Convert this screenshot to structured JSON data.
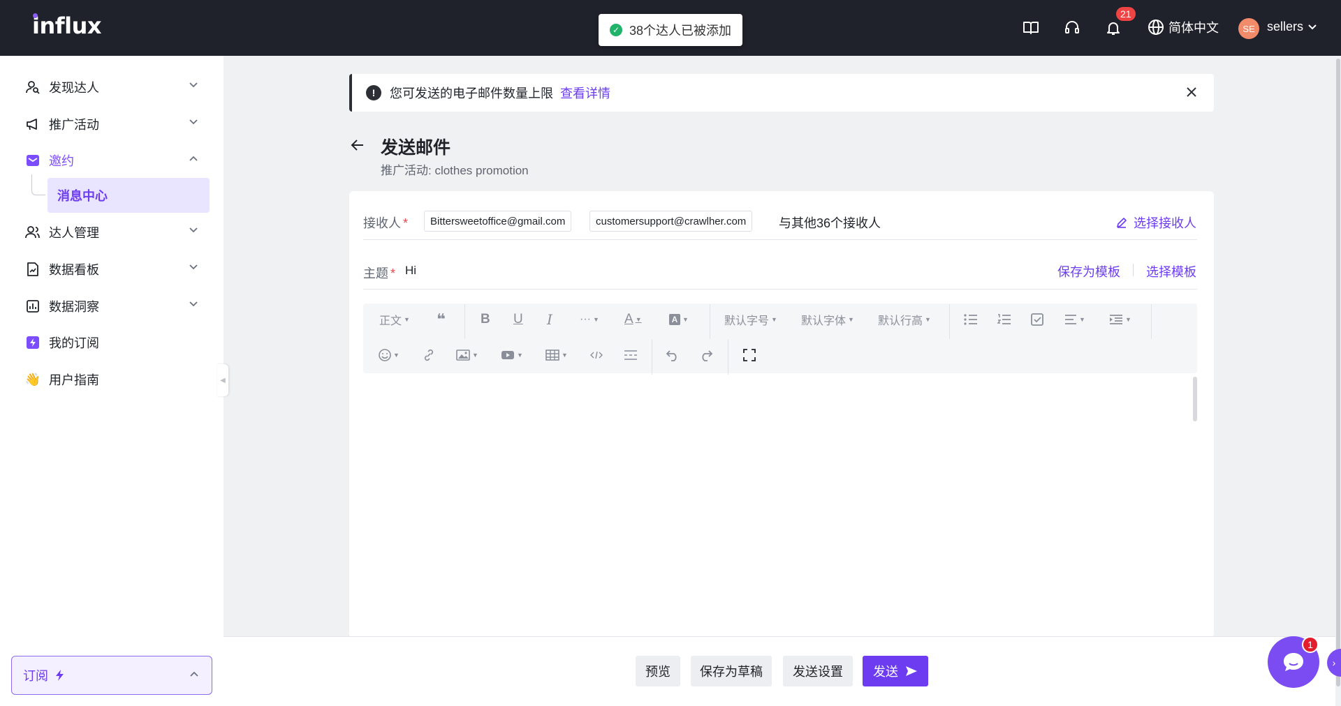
{
  "app": {
    "logo": "influx"
  },
  "toast": {
    "message": "38个达人已被添加",
    "icon": "check-circle-icon",
    "color": "#22b36a"
  },
  "header": {
    "notifications_count": "21",
    "language": "简体中文",
    "avatar_initials": "SE",
    "username": "sellers"
  },
  "sidebar": {
    "items": [
      {
        "label": "发现达人",
        "icon": "user-search-icon"
      },
      {
        "label": "推广活动",
        "icon": "megaphone-icon"
      },
      {
        "label": "邀约",
        "icon": "mail-icon"
      },
      {
        "label": "达人管理",
        "icon": "users-icon"
      },
      {
        "label": "数据看板",
        "icon": "chart-file-icon"
      },
      {
        "label": "数据洞察",
        "icon": "bar-chart-icon"
      },
      {
        "label": "我的订阅",
        "icon": "lightning-icon"
      },
      {
        "label": "用户指南",
        "icon": "waving-hand-icon"
      }
    ],
    "sub_active": "消息中心",
    "subscribe_label": "订阅"
  },
  "notice": {
    "text": "您可发送的电子邮件数量上限",
    "link": "查看详情"
  },
  "page": {
    "title": "发送邮件",
    "subtitle": "推广活动: clothes promotion"
  },
  "form": {
    "recipients_label": "接收人",
    "recipients": [
      "Bittersweetoffice@gmail.com",
      "customersupport@crawlher.com"
    ],
    "others_text": "与其他36个接收人",
    "select_recipients": "选择接收人",
    "subject_label": "主题",
    "subject_value": "Hi",
    "save_template": "保存为模板",
    "select_template": "选择模板"
  },
  "editor": {
    "paragraph": "正文",
    "font_size": "默认字号",
    "font_family": "默认字体",
    "line_height": "默认行高"
  },
  "footer": {
    "preview": "预览",
    "save_draft": "保存为草稿",
    "send_settings": "发送设置",
    "send": "发送"
  },
  "chat": {
    "badge": "1"
  },
  "colors": {
    "accent": "#6d3cf0",
    "topbar": "#1f212b",
    "danger": "#ef4444"
  }
}
